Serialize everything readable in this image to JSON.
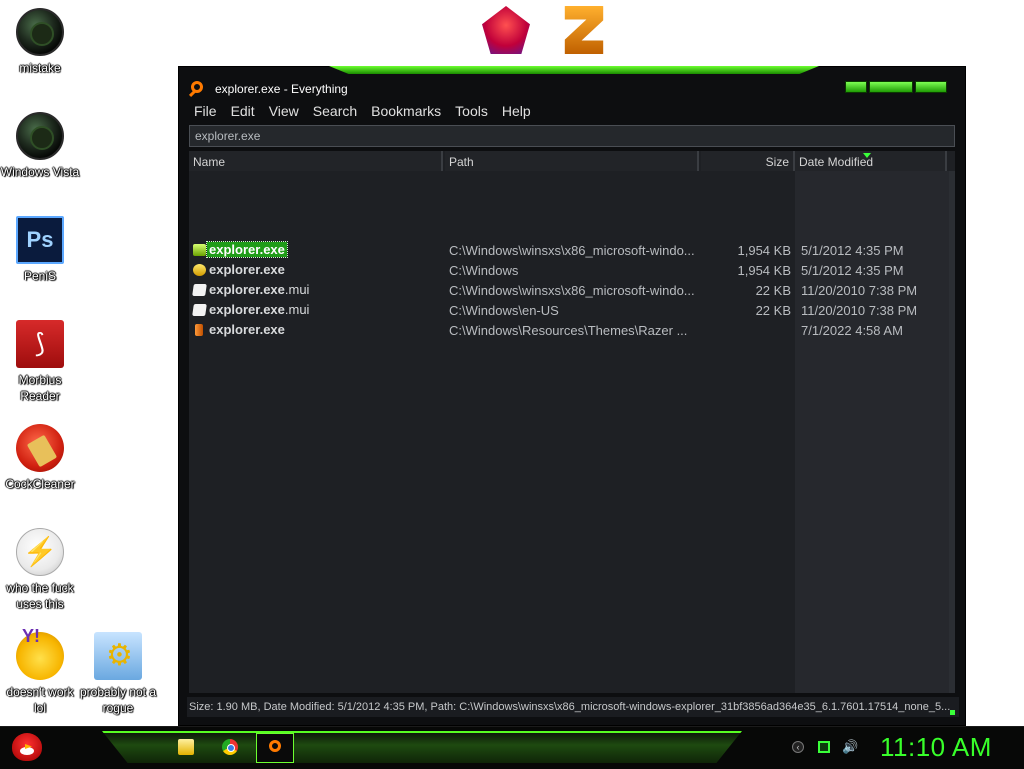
{
  "desktop_icons": [
    {
      "label": "mistake",
      "icon": "razer-orb-icon"
    },
    {
      "label": "Windows Vista",
      "icon": "razer-orb-icon"
    },
    {
      "label": "PeniS",
      "icon": "photoshop-icon"
    },
    {
      "label": "Morbius Reader",
      "icon": "pdf-reader-icon"
    },
    {
      "label": "CockCleaner",
      "icon": "ccleaner-icon"
    },
    {
      "label": "who the fuck uses this",
      "icon": "lightning-icon"
    },
    {
      "label": "doesn't work lol",
      "icon": "yahoo-messenger-icon"
    },
    {
      "label": "probably not a rogue",
      "icon": "gears-icon"
    }
  ],
  "window": {
    "title": "explorer.exe - Everything",
    "menu": [
      "File",
      "Edit",
      "View",
      "Search",
      "Bookmarks",
      "Tools",
      "Help"
    ],
    "search_value": "explorer.exe",
    "columns": [
      "Name",
      "Path",
      "Size",
      "Date Modified"
    ],
    "rows": [
      {
        "name": "explorer.exe",
        "ext": "",
        "path": "C:\\Windows\\winsxs\\x86_microsoft-windo...",
        "size": "1,954 KB",
        "date": "5/1/2012 4:35 PM",
        "icon": "green-exe-icon"
      },
      {
        "name": "explorer.exe",
        "ext": "",
        "path": "C:\\Windows",
        "size": "1,954 KB",
        "date": "5/1/2012 4:35 PM",
        "icon": "yellow-exe-icon"
      },
      {
        "name": "explorer.exe",
        "ext": ".mui",
        "path": "C:\\Windows\\winsxs\\x86_microsoft-windo...",
        "size": "22 KB",
        "date": "11/20/2010 7:38 PM",
        "icon": "document-icon"
      },
      {
        "name": "explorer.exe",
        "ext": ".mui",
        "path": "C:\\Windows\\en-US",
        "size": "22 KB",
        "date": "11/20/2010 7:38 PM",
        "icon": "document-icon"
      },
      {
        "name": "explorer.exe",
        "ext": "",
        "path": "C:\\Windows\\Resources\\Themes\\Razer ...",
        "size": "",
        "date": "7/1/2022 4:58 AM",
        "icon": "theme-exe-icon"
      }
    ],
    "status": "Size: 1.90 MB, Date Modified: 5/1/2012 4:35 PM, Path: C:\\Windows\\winsxs\\x86_microsoft-windows-explorer_31bf3856ad364e35_6.1.7601.17514_none_5..."
  },
  "taskbar": {
    "clock": "11:10 AM",
    "accent": "#38ff2a"
  }
}
